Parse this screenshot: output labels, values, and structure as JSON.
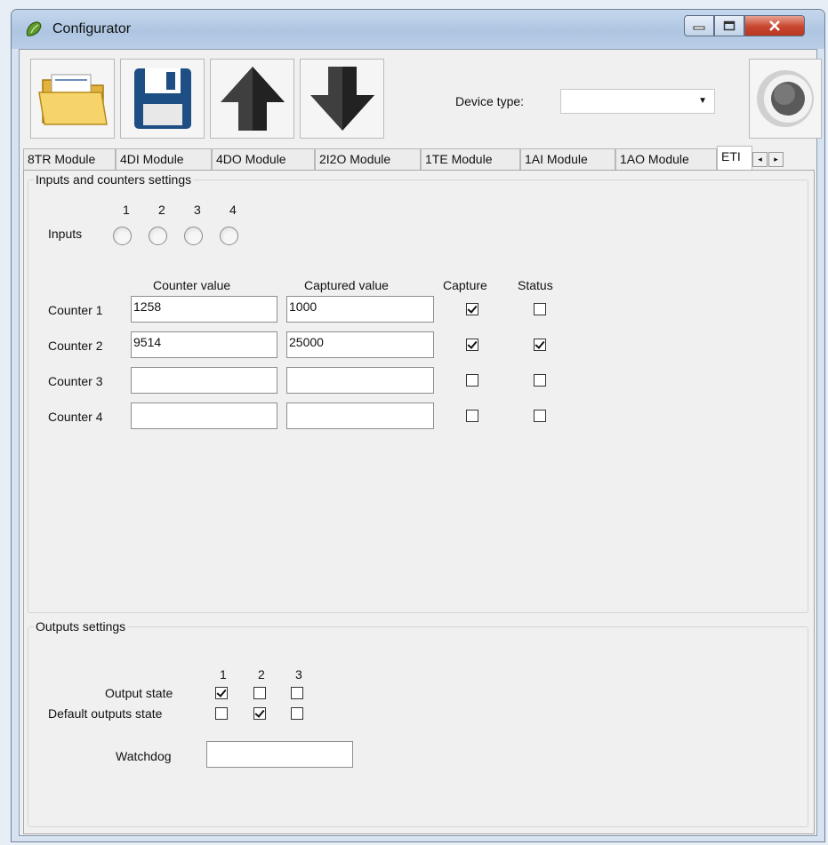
{
  "window": {
    "title": "Configurator"
  },
  "title_buttons": {
    "minimize": "_",
    "maximize": "□",
    "close": "x"
  },
  "toolbar": {
    "open_icon": "folder-open-icon",
    "save_icon": "floppy-disk-icon",
    "upload_icon": "arrow-up-icon",
    "download_icon": "arrow-down-icon",
    "device_type_label": "Device type:",
    "device_type_value": "",
    "record_icon": "record-icon"
  },
  "tabs": [
    {
      "label": "8TR Module"
    },
    {
      "label": "4DI Module"
    },
    {
      "label": "4DO Module"
    },
    {
      "label": "2I2O Module"
    },
    {
      "label": "1TE Module"
    },
    {
      "label": "1AI Module"
    },
    {
      "label": "1AO Module"
    },
    {
      "label": "ETI",
      "active": true
    }
  ],
  "tab_scroll": {
    "left": "◂",
    "right": "▸"
  },
  "inputs_group": {
    "title": "Inputs and counters settings",
    "inputs_label": "Inputs",
    "input_numbers": [
      "1",
      "2",
      "3",
      "4"
    ],
    "columns": {
      "counter_value": "Counter value",
      "captured_value": "Captured value",
      "capture": "Capture",
      "status": "Status"
    },
    "counters": [
      {
        "label": "Counter 1",
        "counter_value": "1258",
        "captured_value": "1000",
        "capture": true,
        "status": false
      },
      {
        "label": "Counter 2",
        "counter_value": "9514",
        "captured_value": "25000",
        "capture": true,
        "status": true
      },
      {
        "label": "Counter 3",
        "counter_value": "",
        "captured_value": "",
        "capture": false,
        "status": false
      },
      {
        "label": "Counter 4",
        "counter_value": "",
        "captured_value": "",
        "capture": false,
        "status": false
      }
    ]
  },
  "outputs_group": {
    "title": "Outputs settings",
    "output_numbers": [
      "1",
      "2",
      "3"
    ],
    "output_state_label": "Output state",
    "output_state": [
      true,
      false,
      false
    ],
    "default_state_label": "Default outputs state",
    "default_state": [
      false,
      true,
      false
    ],
    "watchdog_label": "Watchdog",
    "watchdog_value": ""
  }
}
